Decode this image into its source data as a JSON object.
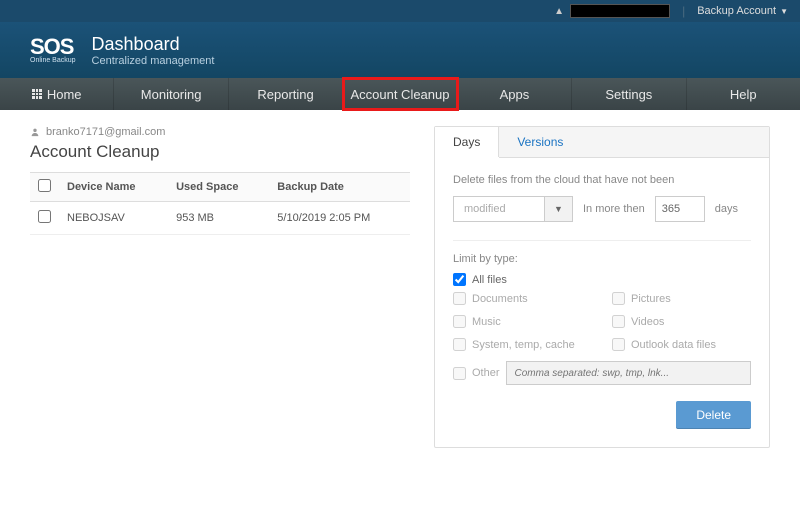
{
  "topbar": {
    "user_icon": "person-icon",
    "backup_label": "Backup Account"
  },
  "header": {
    "logo_main": "SOS",
    "logo_sub": "Online Backup",
    "title": "Dashboard",
    "subtitle": "Centralized management"
  },
  "nav": {
    "home": "Home",
    "monitoring": "Monitoring",
    "reporting": "Reporting",
    "cleanup": "Account Cleanup",
    "apps": "Apps",
    "settings": "Settings",
    "help": "Help"
  },
  "page": {
    "user_email": "branko7171@gmail.com",
    "title": "Account Cleanup",
    "table": {
      "cols": {
        "device": "Device Name",
        "space": "Used Space",
        "date": "Backup Date"
      },
      "rows": [
        {
          "device": "NEBOJSAV",
          "space": "953 MB",
          "date": "5/10/2019 2:05 PM"
        }
      ]
    }
  },
  "panel": {
    "tabs": {
      "days": "Days",
      "versions": "Versions"
    },
    "delete_intro": "Delete files from the cloud that have not been",
    "select_value": "modified",
    "more_than_label": "In more then",
    "days_value": "365",
    "days_suffix": "days",
    "limit_label": "Limit by type:",
    "opts": {
      "all": "All files",
      "documents": "Documents",
      "pictures": "Pictures",
      "music": "Music",
      "videos": "Videos",
      "system": "System, temp, cache",
      "outlook": "Outlook data files",
      "other": "Other"
    },
    "other_placeholder": "Comma separated: swp, tmp, lnk...",
    "delete_btn": "Delete"
  }
}
